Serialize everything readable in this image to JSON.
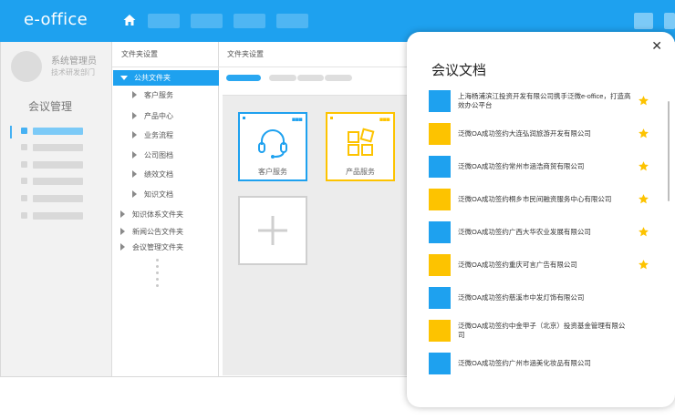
{
  "topbar": {
    "brand": "e-office",
    "bg_color": "#1ea1ef"
  },
  "user": {
    "name": "系统管理员",
    "department": "技术研发部门"
  },
  "left_menu": {
    "module_title": "会议管理",
    "item_count": 6
  },
  "folder_tree": {
    "header": "文件夹设置",
    "selected": "公共文件夹",
    "children": [
      "客户服务",
      "产品中心",
      "业务流程",
      "公司图档",
      "绩效文档",
      "知识文档"
    ],
    "root_items": [
      "知识体系文件夹",
      "新闻公告文件夹",
      "会议管理文件夹"
    ]
  },
  "content": {
    "header": "文件夹设置",
    "folders": [
      {
        "label": "客户服务",
        "icon": "headset-icon",
        "color": "#1ea1ef"
      },
      {
        "label": "产品服务",
        "icon": "product-blocks-icon",
        "color": "#fdc300"
      }
    ],
    "add_icon": "plus-icon"
  },
  "popup": {
    "title": "会议文档",
    "close_icon": "close-icon",
    "items": [
      {
        "text": "上海杨浦滨江投资开发有限公司携手泛微e-office，打造高效办公平台",
        "color": "#1ea1ef",
        "starred": true
      },
      {
        "text": "泛微OA成功签约大连弘润旅游开发有限公司",
        "color": "#fdc300",
        "starred": true
      },
      {
        "text": "泛微OA成功签约常州市涵浩商贸有限公司",
        "color": "#1ea1ef",
        "starred": true
      },
      {
        "text": "泛微OA成功签约桐乡市民间融资服务中心有限公司",
        "color": "#fdc300",
        "starred": true
      },
      {
        "text": "泛微OA成功签约广西大华农业发展有限公司",
        "color": "#1ea1ef",
        "starred": true
      },
      {
        "text": "泛微OA成功签约重庆可言广告有限公司",
        "color": "#fdc300",
        "starred": true
      },
      {
        "text": "泛微OA成功签约慈溪市中发灯饰有限公司",
        "color": "#1ea1ef",
        "starred": false
      },
      {
        "text": "泛微OA成功签约中金甲子（北京）投资基金管理有限公司",
        "color": "#fdc300",
        "starred": false
      },
      {
        "text": "泛微OA成功签约广州市涵美化妆品有限公司",
        "color": "#1ea1ef",
        "starred": false
      }
    ]
  },
  "colors": {
    "accent_blue": "#1ea1ef",
    "accent_yellow": "#fdc300"
  }
}
